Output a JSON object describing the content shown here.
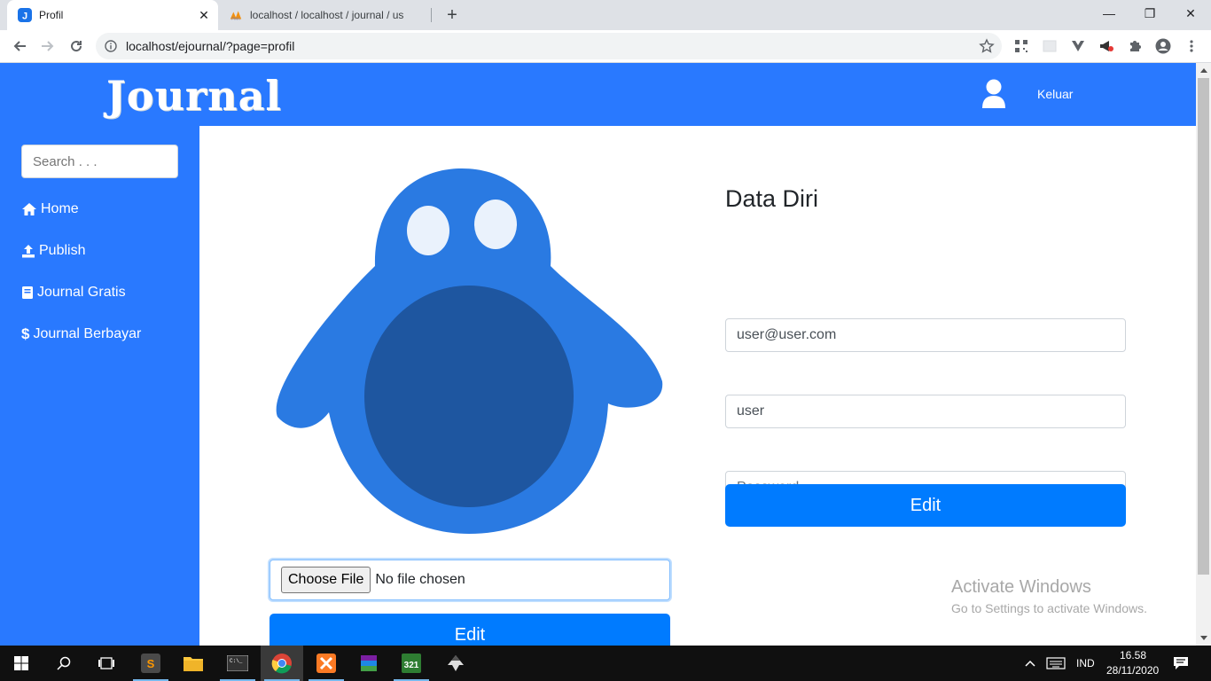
{
  "browser": {
    "tabs": [
      {
        "title": "Profil",
        "active": true
      },
      {
        "title": "localhost / localhost / journal / us",
        "active": false
      }
    ],
    "url": "localhost/ejournal/?page=profil"
  },
  "header": {
    "logo_text": "Journal",
    "logout_label": "Keluar"
  },
  "sidebar": {
    "search_placeholder": "Search . . .",
    "items": [
      {
        "label": "Home",
        "icon": "home-icon"
      },
      {
        "label": "Publish",
        "icon": "upload-icon"
      },
      {
        "label": "Journal Gratis",
        "icon": "book-icon"
      },
      {
        "label": "Journal Berbayar",
        "icon": "dollar-icon"
      }
    ]
  },
  "profile": {
    "choose_file_label": "Choose File",
    "no_file_text": "No file chosen",
    "edit_photo_label": "Edit"
  },
  "form": {
    "title": "Data Diri",
    "email_value": "user@user.com",
    "username_value": "user",
    "password_placeholder": "Password",
    "submit_label": "Edit"
  },
  "watermark": {
    "line1": "Activate Windows",
    "line2": "Go to Settings to activate Windows."
  },
  "taskbar": {
    "language": "IND",
    "time": "16.58",
    "date": "28/11/2020"
  },
  "colors": {
    "brand_blue": "#2979ff",
    "button_blue": "#007bff",
    "avatar_body": "#2a7ae2",
    "avatar_belly": "#1e56a0"
  }
}
